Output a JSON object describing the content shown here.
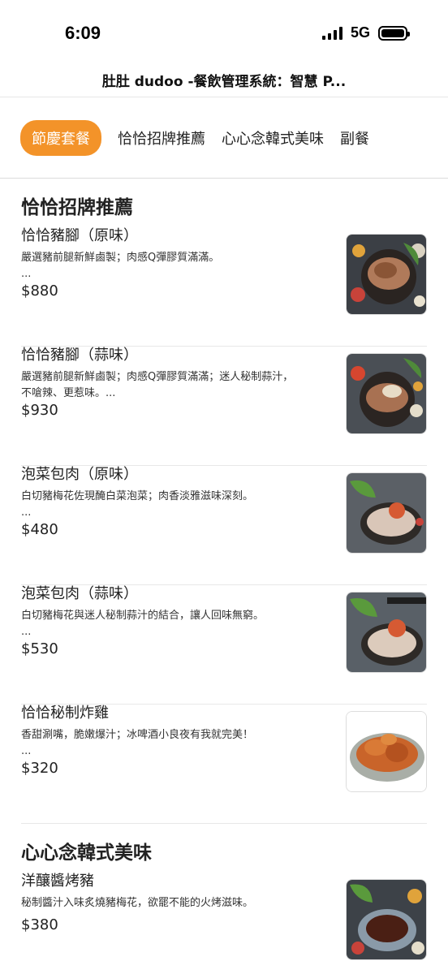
{
  "status": {
    "time": "6:09",
    "network": "5G"
  },
  "nav": {
    "title": "肚肚 dudoo -餐飲管理系統：智慧 P..."
  },
  "tabs": [
    {
      "label": "節慶套餐",
      "active": true
    },
    {
      "label": "恰恰招牌推薦",
      "active": false
    },
    {
      "label": "心心念韓式美味",
      "active": false
    },
    {
      "label": "副餐",
      "active": false
    }
  ],
  "sections": [
    {
      "title": "恰恰招牌推薦",
      "items": [
        {
          "name": "恰恰豬腳（原味）",
          "desc": "嚴選豬前腿新鮮鹵製；肉感Q彈膠質滿滿。",
          "desc2": "...",
          "price": "$880",
          "image": "pork-knuckle-photo"
        },
        {
          "name": "恰恰豬腳（蒜味）",
          "desc": "嚴選豬前腿新鮮鹵製；肉感Q彈膠質滿滿；迷人秘制蒜汁，",
          "desc2": "不嗆辣、更惹味。...",
          "price": "$930",
          "image": "garlic-pork-knuckle-photo"
        },
        {
          "name": "泡菜包肉（原味）",
          "desc": "白切豬梅花佐現醃白菜泡菜；肉香淡雅滋味深刻。",
          "desc2": "...",
          "price": "$480",
          "image": "kimchi-pork-photo"
        },
        {
          "name": "泡菜包肉（蒜味）",
          "desc": "白切豬梅花與迷人秘制蒜汁的結合，讓人回味無窮。",
          "desc2": "...",
          "price": "$530",
          "image": "garlic-kimchi-pork-photo"
        },
        {
          "name": "恰恰秘制炸雞",
          "desc": "香甜涮嘴，脆嫩爆汁；冰啤酒小良夜有我就完美！",
          "desc2": "...",
          "price": "$320",
          "image": "fried-chicken-photo"
        }
      ]
    },
    {
      "title": "心心念韓式美味",
      "items": [
        {
          "name": "洋釀醬烤豬",
          "desc": "秘制醬汁入味炙燒豬梅花，欲罷不能的火烤滋味。",
          "desc2": "",
          "price": "$380",
          "image": "bbq-pork-photo"
        }
      ]
    }
  ],
  "colors": {
    "accent": "#f39329",
    "text": "#222222",
    "divider": "#e8e8e8"
  }
}
